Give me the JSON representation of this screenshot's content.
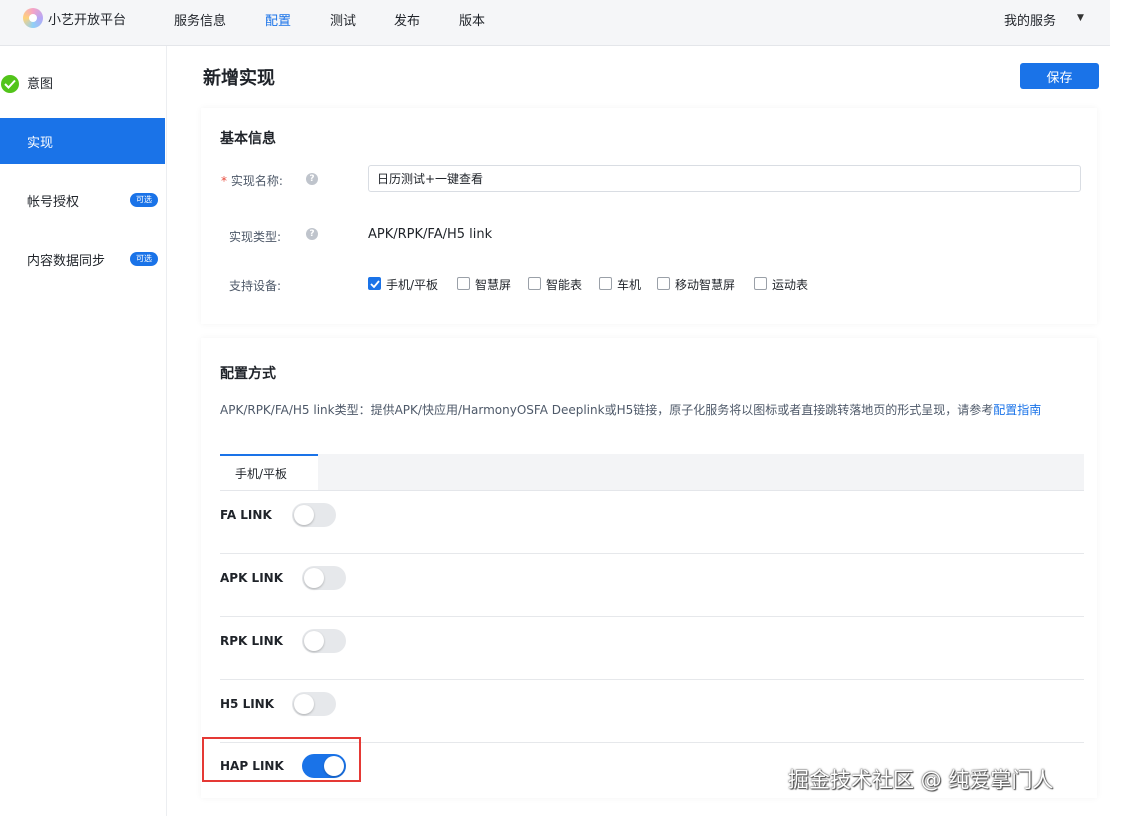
{
  "header": {
    "brand": "小艺开放平台",
    "nav": [
      "服务信息",
      "配置",
      "测试",
      "发布",
      "版本"
    ],
    "active_nav": "配置",
    "my_service": "我的服务"
  },
  "sidebar": {
    "items": [
      {
        "label": "意图",
        "status": "completed"
      },
      {
        "label": "实现",
        "active": true
      },
      {
        "label": "帐号授权",
        "badge": "可选"
      },
      {
        "label": "内容数据同步",
        "badge": "可选"
      }
    ]
  },
  "page": {
    "title": "新增实现",
    "save_label": "保存"
  },
  "basic_info": {
    "title": "基本信息",
    "name_label": "实现名称:",
    "name_value": "日历测试+一键查看",
    "type_label": "实现类型:",
    "type_value": "APK/RPK/FA/H5 link",
    "devices_label": "支持设备:",
    "devices": [
      {
        "label": "手机/平板",
        "checked": true
      },
      {
        "label": "智慧屏",
        "checked": false
      },
      {
        "label": "智能表",
        "checked": false
      },
      {
        "label": "车机",
        "checked": false
      },
      {
        "label": "移动智慧屏",
        "checked": false
      },
      {
        "label": "运动表",
        "checked": false
      }
    ]
  },
  "config": {
    "title": "配置方式",
    "description": "APK/RPK/FA/H5 link类型：提供APK/快应用/HarmonyOSFA Deeplink或H5链接，原子化服务将以图标或者直接跳转落地页的形式呈现，请参考",
    "guide_link": "配置指南",
    "tab": "手机/平板",
    "links": [
      {
        "label": "FA LINK",
        "enabled": false
      },
      {
        "label": "APK LINK",
        "enabled": false
      },
      {
        "label": "RPK LINK",
        "enabled": false
      },
      {
        "label": "H5 LINK",
        "enabled": false
      },
      {
        "label": "HAP LINK",
        "enabled": true
      }
    ]
  },
  "watermark": "掘金技术社区 @ 纯爱掌门人",
  "colors": {
    "accent": "#1a73e8",
    "success": "#52c41a",
    "highlight": "#e53935"
  }
}
